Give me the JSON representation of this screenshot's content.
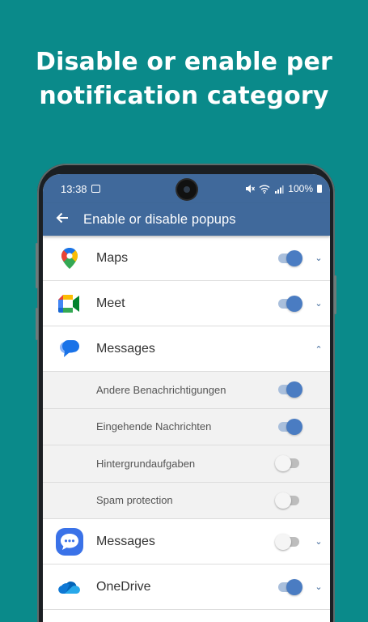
{
  "promo": {
    "line1": "Disable or enable per",
    "line2": "notification category"
  },
  "status_bar": {
    "time": "13:38",
    "battery": "100%"
  },
  "app_bar": {
    "title": "Enable or disable popups",
    "back_icon": "arrow-left-icon"
  },
  "apps": [
    {
      "name": "Maps",
      "icon": "google-maps-icon",
      "enabled": true,
      "expanded": false
    },
    {
      "name": "Meet",
      "icon": "google-meet-icon",
      "enabled": true,
      "expanded": false
    },
    {
      "name": "Messages",
      "icon": "google-messages-icon",
      "enabled": null,
      "expanded": true,
      "categories": [
        {
          "name": "Andere Benachrichtigungen",
          "enabled": true
        },
        {
          "name": "Eingehende Nachrichten",
          "enabled": true
        },
        {
          "name": "Hintergrundaufgaben",
          "enabled": false
        },
        {
          "name": "Spam protection",
          "enabled": false
        }
      ]
    },
    {
      "name": "Messages",
      "icon": "samsung-messages-icon",
      "enabled": false,
      "expanded": false
    },
    {
      "name": "OneDrive",
      "icon": "onedrive-icon",
      "enabled": true,
      "expanded": false
    }
  ],
  "colors": {
    "background": "#0a8a8a",
    "app_bar": "#40699b",
    "toggle_on": "#4a7cc2",
    "toggle_off": "#f5f5f5"
  }
}
